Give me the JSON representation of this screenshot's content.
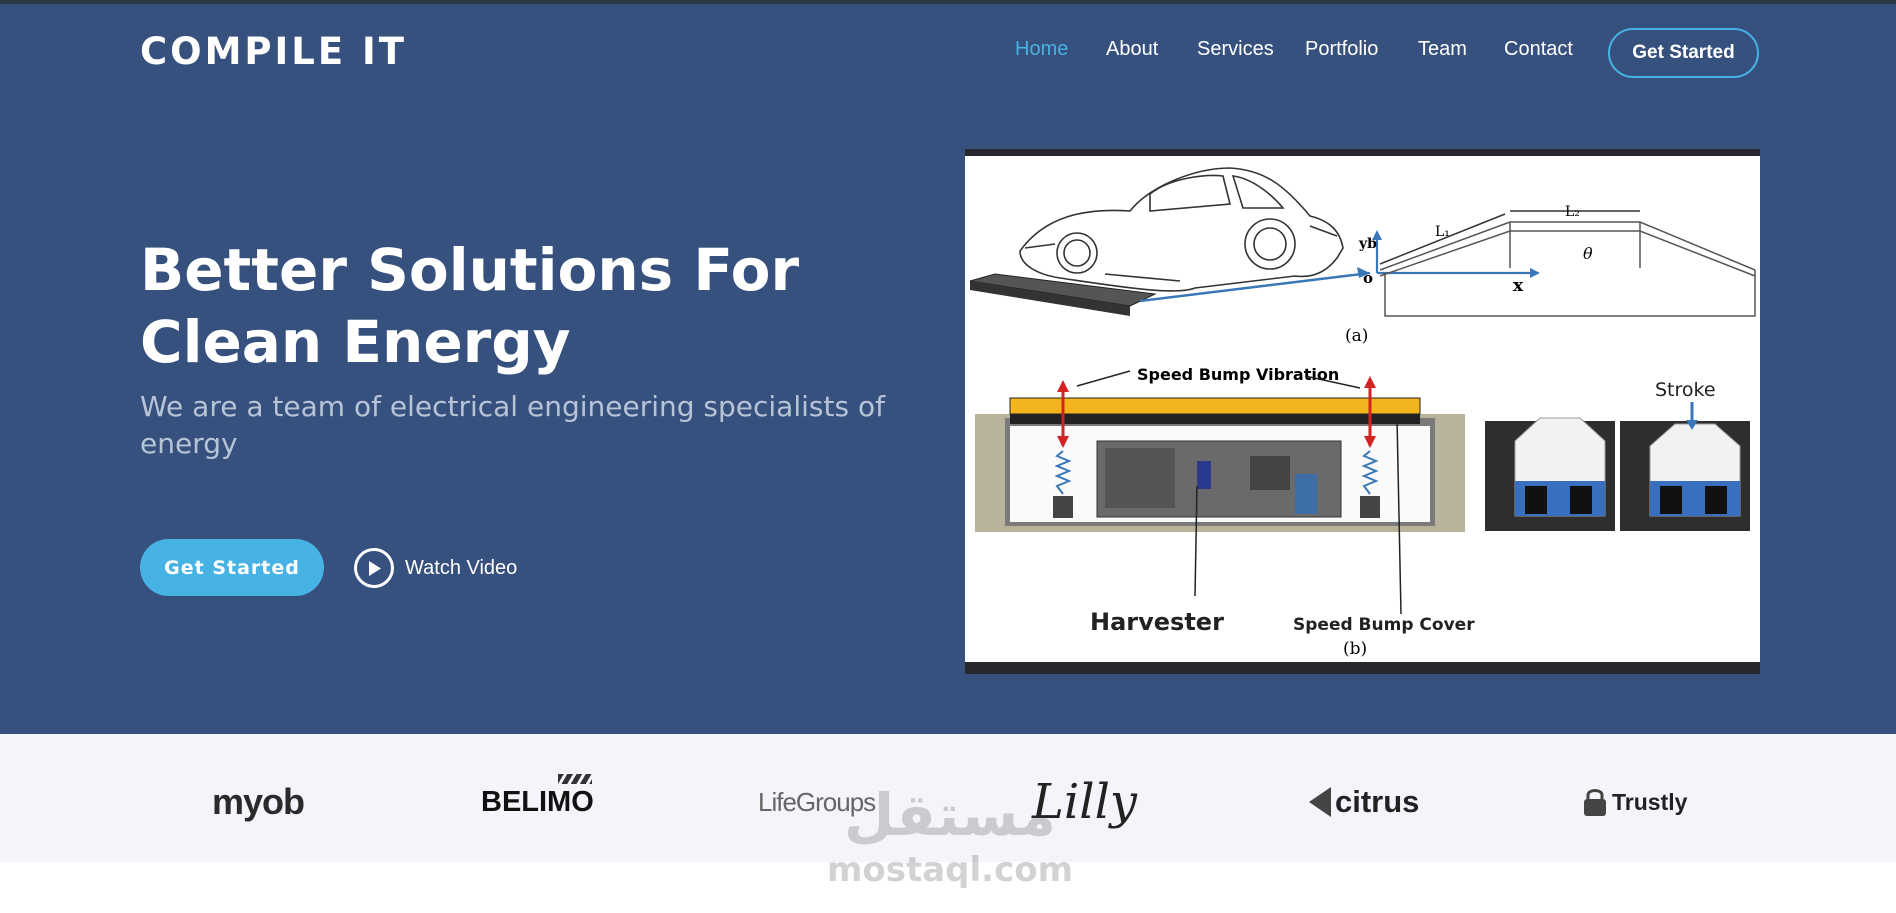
{
  "header": {
    "logo": "COMPILE IT",
    "nav": [
      {
        "label": "Home",
        "active": true
      },
      {
        "label": "About"
      },
      {
        "label": "Services"
      },
      {
        "label": "Portfolio"
      },
      {
        "label": "Team"
      },
      {
        "label": "Contact"
      }
    ],
    "cta_label": "Get Started"
  },
  "hero": {
    "title": "Better Solutions For Clean Energy",
    "subtitle": "We are a team of electrical engineering specialists of energy",
    "primary_button": "Get Started",
    "video_button": "Watch Video",
    "video_icon": "play-circle-icon"
  },
  "figure": {
    "labels": {
      "yb": "yb",
      "o": "o",
      "x": "x",
      "l1": "L₁",
      "l2": "L₂",
      "theta": "θ",
      "panel_a": "(a)",
      "speed_bump_vibration": "Speed Bump Vibration",
      "stroke": "Stroke",
      "harvester": "Harvester",
      "speed_bump_cover": "Speed Bump Cover",
      "panel_b": "(b)"
    }
  },
  "clients": [
    "myob",
    "BELIMO",
    "LifeGroups",
    "Lilly",
    "citrus",
    "Trustly"
  ],
  "watermark": {
    "arabic": "مستقل",
    "domain": "mostaql.com"
  },
  "colors": {
    "hero_bg": "#37517e",
    "accent": "#47b2e4",
    "clients_bg": "#f3f5fa"
  }
}
